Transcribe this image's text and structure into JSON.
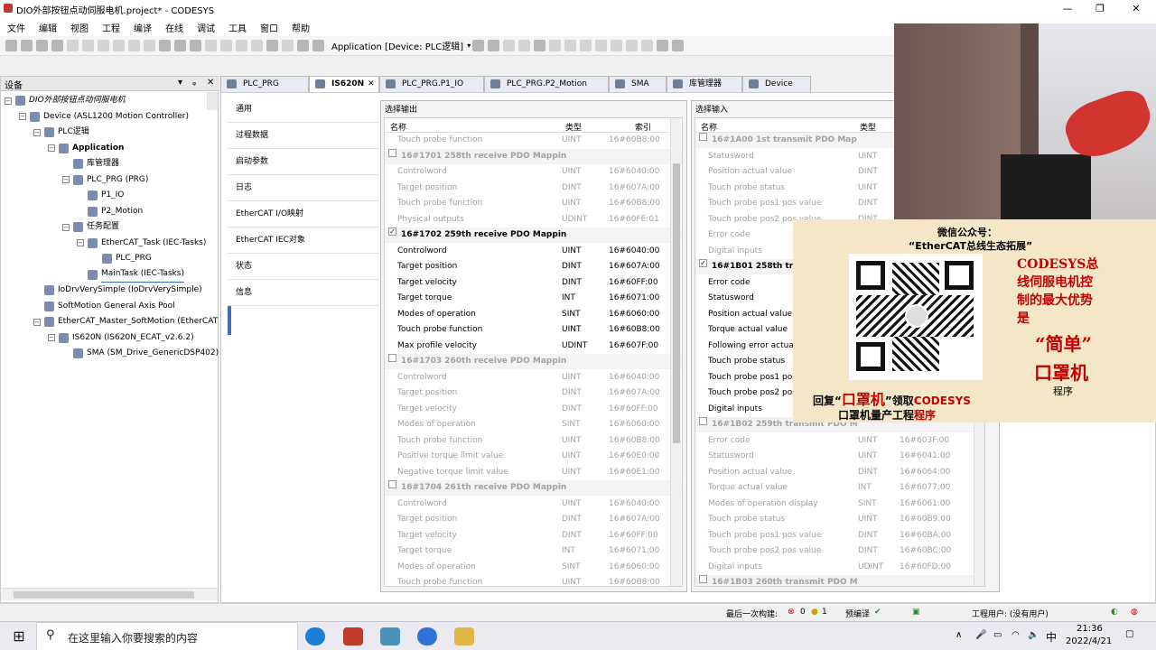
{
  "window": {
    "title": "DIO外部按钮点动伺服电机.project* - CODESYS",
    "controls": [
      "—",
      "❐",
      "✕"
    ]
  },
  "menu": [
    "文件",
    "编辑",
    "视图",
    "工程",
    "编译",
    "在线",
    "调试",
    "工具",
    "窗口",
    "帮助"
  ],
  "toolbar": {
    "application_label": "Application [Device: PLC逻辑]"
  },
  "devices_panel": {
    "title": "设备",
    "tree": [
      {
        "label": "DIO外部按钮点动伺服电机",
        "toggle": "−",
        "icon": "project-icon"
      },
      {
        "label": "Device (ASL1200 Motion Controller)",
        "toggle": "−",
        "icon": "device-icon"
      },
      {
        "label": "PLC逻辑",
        "toggle": "−",
        "icon": "plc-logic-icon"
      },
      {
        "label": "Application",
        "toggle": "−",
        "icon": "application-icon"
      },
      {
        "label": "库管理器",
        "toggle": "",
        "icon": "library-manager-icon"
      },
      {
        "label": "PLC_PRG (PRG)",
        "toggle": "−",
        "icon": "program-icon"
      },
      {
        "label": "P1_IO",
        "toggle": "",
        "icon": "action-icon"
      },
      {
        "label": "P2_Motion",
        "toggle": "",
        "icon": "action-icon"
      },
      {
        "label": "任务配置",
        "toggle": "−",
        "icon": "task-config-icon"
      },
      {
        "label": "EtherCAT_Task (IEC-Tasks)",
        "toggle": "−",
        "icon": "task-icon"
      },
      {
        "label": "PLC_PRG",
        "toggle": "",
        "icon": "program-call-icon"
      },
      {
        "label": "MainTask (IEC-Tasks)",
        "toggle": "",
        "icon": "task-icon"
      },
      {
        "label": "IoDrvVerySimple (IoDrvVerySimple)",
        "toggle": "",
        "icon": "io-driver-icon"
      },
      {
        "label": "SoftMotion General Axis Pool",
        "toggle": "",
        "icon": "axis-pool-icon"
      },
      {
        "label": "EtherCAT_Master_SoftMotion (EtherCAT M",
        "toggle": "−",
        "icon": "ethercat-master-icon"
      },
      {
        "label": "IS620N (IS620N_ECAT_v2.6.2)",
        "toggle": "−",
        "icon": "ethercat-slave-icon"
      },
      {
        "label": "SMA (SM_Drive_GenericDSP402)",
        "toggle": "",
        "icon": "drive-icon"
      }
    ]
  },
  "tabs": [
    {
      "label": "PLC_PRG",
      "active": false
    },
    {
      "label": "IS620N",
      "active": true
    },
    {
      "label": "PLC_PRG.P1_IO",
      "active": false
    },
    {
      "label": "PLC_PRG.P2_Motion",
      "active": false
    },
    {
      "label": "SMA",
      "active": false
    },
    {
      "label": "库管理器",
      "active": false
    },
    {
      "label": "Device",
      "active": false
    }
  ],
  "left_nav": [
    "通用",
    "过程数据",
    "启动参数",
    "日志",
    "EtherCAT I/O映射",
    "EtherCAT IEC对象",
    "状态",
    "信息"
  ],
  "output_panel": {
    "title": "选择输出",
    "headers": [
      "名称",
      "类型",
      "索引"
    ],
    "rows": [
      {
        "kind": "item",
        "name": "Touch probe function",
        "type": "UINT",
        "index": "16#60B8:00",
        "dim": true
      },
      {
        "kind": "group",
        "name": "16#1701 258th receive PDO Mappin",
        "checked": false,
        "dim": true
      },
      {
        "kind": "item",
        "name": "Controlword",
        "type": "UINT",
        "index": "16#6040:00",
        "dim": true
      },
      {
        "kind": "item",
        "name": "Target position",
        "type": "DINT",
        "index": "16#607A:00",
        "dim": true
      },
      {
        "kind": "item",
        "name": "Touch probe function",
        "type": "UINT",
        "index": "16#60B8:00",
        "dim": true
      },
      {
        "kind": "item",
        "name": "Physical outputs",
        "type": "UDINT",
        "index": "16#60FE:01",
        "dim": true
      },
      {
        "kind": "group",
        "name": "16#1702 259th receive PDO Mappin",
        "checked": true,
        "dim": false
      },
      {
        "kind": "item",
        "name": "Controlword",
        "type": "UINT",
        "index": "16#6040:00",
        "dim": false
      },
      {
        "kind": "item",
        "name": "Target position",
        "type": "DINT",
        "index": "16#607A:00",
        "dim": false
      },
      {
        "kind": "item",
        "name": "Target velocity",
        "type": "DINT",
        "index": "16#60FF:00",
        "dim": false
      },
      {
        "kind": "item",
        "name": "Target torque",
        "type": "INT",
        "index": "16#6071:00",
        "dim": false
      },
      {
        "kind": "item",
        "name": "Modes of operation",
        "type": "SINT",
        "index": "16#6060:00",
        "dim": false
      },
      {
        "kind": "item",
        "name": "Touch probe function",
        "type": "UINT",
        "index": "16#60B8:00",
        "dim": false
      },
      {
        "kind": "item",
        "name": "Max profile velocity",
        "type": "UDINT",
        "index": "16#607F:00",
        "dim": false
      },
      {
        "kind": "group",
        "name": "16#1703 260th receive PDO Mappin",
        "checked": false,
        "dim": true
      },
      {
        "kind": "item",
        "name": "Controlword",
        "type": "UINT",
        "index": "16#6040:00",
        "dim": true
      },
      {
        "kind": "item",
        "name": "Target position",
        "type": "DINT",
        "index": "16#607A:00",
        "dim": true
      },
      {
        "kind": "item",
        "name": "Target velocity",
        "type": "DINT",
        "index": "16#60FF:00",
        "dim": true
      },
      {
        "kind": "item",
        "name": "Modes of operation",
        "type": "SINT",
        "index": "16#6060:00",
        "dim": true
      },
      {
        "kind": "item",
        "name": "Touch probe function",
        "type": "UINT",
        "index": "16#60B8:00",
        "dim": true
      },
      {
        "kind": "item",
        "name": "Positive torque limit value",
        "type": "UINT",
        "index": "16#60E0:00",
        "dim": true
      },
      {
        "kind": "item",
        "name": "Negative torque limit value",
        "type": "UINT",
        "index": "16#60E1:00",
        "dim": true
      },
      {
        "kind": "group",
        "name": "16#1704 261th receive PDO Mappin",
        "checked": false,
        "dim": true
      },
      {
        "kind": "item",
        "name": "Controlword",
        "type": "UINT",
        "index": "16#6040:00",
        "dim": true
      },
      {
        "kind": "item",
        "name": "Target position",
        "type": "DINT",
        "index": "16#607A:00",
        "dim": true
      },
      {
        "kind": "item",
        "name": "Target velocity",
        "type": "DINT",
        "index": "16#60FF:00",
        "dim": true
      },
      {
        "kind": "item",
        "name": "Target torque",
        "type": "INT",
        "index": "16#6071:00",
        "dim": true
      },
      {
        "kind": "item",
        "name": "Modes of operation",
        "type": "SINT",
        "index": "16#6060:00",
        "dim": true
      },
      {
        "kind": "item",
        "name": "Touch probe function",
        "type": "UINT",
        "index": "16#60B8:00",
        "dim": true
      }
    ]
  },
  "input_panel": {
    "title": "选择输入",
    "headers": [
      "名称",
      "类型"
    ],
    "rows": [
      {
        "kind": "group",
        "name": "16#1A00 1st transmit PDO Map",
        "checked": false,
        "dim": true
      },
      {
        "kind": "item",
        "name": "Statusword",
        "type": "UINT",
        "index": "",
        "dim": true
      },
      {
        "kind": "item",
        "name": "Position actual value",
        "type": "DINT",
        "index": "",
        "dim": true
      },
      {
        "kind": "item",
        "name": "Touch probe status",
        "type": "UINT",
        "index": "",
        "dim": true
      },
      {
        "kind": "item",
        "name": "Touch probe pos1 pos value",
        "type": "DINT",
        "index": "",
        "dim": true
      },
      {
        "kind": "item",
        "name": "Touch probe pos2 pos value",
        "type": "DINT",
        "index": "",
        "dim": true
      },
      {
        "kind": "item",
        "name": "Error code",
        "type": "",
        "index": "",
        "dim": true
      },
      {
        "kind": "item",
        "name": "Digital inputs",
        "type": "",
        "index": "",
        "dim": true
      },
      {
        "kind": "group",
        "name": "16#1B01 258th tra",
        "checked": true,
        "dim": false
      },
      {
        "kind": "item",
        "name": "Error code",
        "type": "",
        "index": "",
        "dim": false
      },
      {
        "kind": "item",
        "name": "Statusword",
        "type": "",
        "index": "",
        "dim": false
      },
      {
        "kind": "item",
        "name": "Position actual value",
        "type": "",
        "index": "",
        "dim": false
      },
      {
        "kind": "item",
        "name": "Torque actual value",
        "type": "",
        "index": "",
        "dim": false
      },
      {
        "kind": "item",
        "name": "Following error actual",
        "type": "",
        "index": "",
        "dim": false
      },
      {
        "kind": "item",
        "name": "Touch probe status",
        "type": "",
        "index": "",
        "dim": false
      },
      {
        "kind": "item",
        "name": "Touch probe pos1 pos",
        "type": "",
        "index": "",
        "dim": false
      },
      {
        "kind": "item",
        "name": "Touch probe pos2 pos",
        "type": "",
        "index": "",
        "dim": false
      },
      {
        "kind": "item",
        "name": "Digital inputs",
        "type": "",
        "index": "",
        "dim": false
      },
      {
        "kind": "group",
        "name": "16#1B02 259th transmit PDO M",
        "checked": false,
        "dim": true
      },
      {
        "kind": "item",
        "name": "Error code",
        "type": "UINT",
        "index": "16#603F:00",
        "dim": true
      },
      {
        "kind": "item",
        "name": "Statusword",
        "type": "UINT",
        "index": "16#6041:00",
        "dim": true
      },
      {
        "kind": "item",
        "name": "Position actual value",
        "type": "DINT",
        "index": "16#6064:00",
        "dim": true
      },
      {
        "kind": "item",
        "name": "Torque actual value",
        "type": "INT",
        "index": "16#6077:00",
        "dim": true
      },
      {
        "kind": "item",
        "name": "Modes of operation display",
        "type": "SINT",
        "index": "16#6061:00",
        "dim": true
      },
      {
        "kind": "item",
        "name": "Touch probe status",
        "type": "UINT",
        "index": "16#60B9:00",
        "dim": true
      },
      {
        "kind": "item",
        "name": "Touch probe pos1 pos value",
        "type": "DINT",
        "index": "16#60BA:00",
        "dim": true
      },
      {
        "kind": "item",
        "name": "Touch probe pos2 pos value",
        "type": "DINT",
        "index": "16#60BC:00",
        "dim": true
      },
      {
        "kind": "item",
        "name": "Digital inputs",
        "type": "UDINT",
        "index": "16#60FD:00",
        "dim": true
      },
      {
        "kind": "group",
        "name": "16#1B03 260th transmit PDO M",
        "checked": false,
        "dim": true
      }
    ]
  },
  "overlay": {
    "wechat_title": "微信公众号：",
    "wechat_name": "“EtherCAT总线生态拓展”",
    "reply_prefix": "回复“",
    "reply_keyword": "口罩机",
    "reply_suffix": "”领取",
    "reply_brand": "CODESYS",
    "line2_a": "口罩机量产工程",
    "line2_b": "程序",
    "promo_lines": [
      "CODESYS总",
      "线伺服电机控",
      "制的最大优势",
      "是"
    ],
    "simple": "“简单”",
    "mask_machine": "口罩机",
    "program": "程序"
  },
  "statusbar": {
    "last_build": "最后一次构建:",
    "errors": "0",
    "warnings": "0",
    "messages": "1",
    "precompile": "预编译",
    "project_user": "工程用户: (没有用户)"
  },
  "taskbar": {
    "search_placeholder": "在这里输入你要搜索的内容",
    "ime": "中",
    "time": "21:36",
    "date": "2022/4/21"
  },
  "colors": {
    "accent_blue": "#3c6eb4",
    "overlay_bg": "#f3e7c7",
    "promo_red": "#c40000"
  }
}
